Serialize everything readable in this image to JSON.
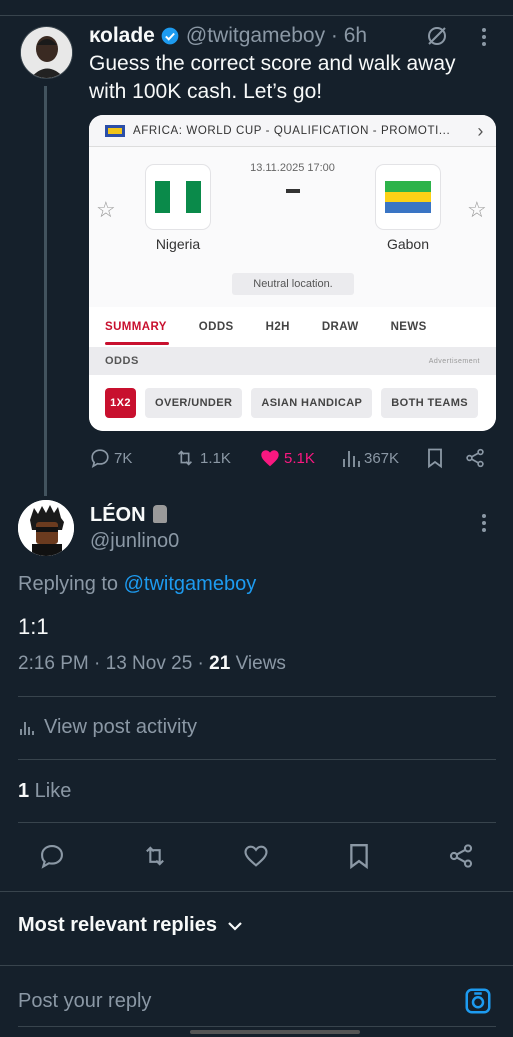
{
  "tweet": {
    "name": "κοlade",
    "handle": "@twitgameboy · 6h",
    "text": "Guess the correct score and walk away with 100K cash. Let’s go!",
    "card": {
      "competition": "AFRICA: WORLD CUP - QUALIFICATION - PROMOTI...",
      "datetime": "13.11.2025 17:00",
      "score": "-",
      "home_team": "Nigeria",
      "away_team": "Gabon",
      "venue_note": "Neutral location.",
      "tabs": [
        "SUMMARY",
        "ODDS",
        "H2H",
        "DRAW",
        "NEWS"
      ],
      "odds_label": "ODDS",
      "ad_label": "Advertisement",
      "pills": [
        "1X2",
        "OVER/UNDER",
        "ASIAN HANDICAP",
        "BOTH TEAMS"
      ]
    },
    "stats": {
      "replies": "7K",
      "reposts": "1.1K",
      "likes": "5.1K",
      "views": "367K"
    }
  },
  "reply": {
    "name": "LÉON",
    "handle": "@junlino0",
    "replying_prefix": "Replying to ",
    "replying_handle": "@twitgameboy",
    "text": "1:1",
    "time": "2:16 PM · 13 Nov 25 · ",
    "views_count": "21",
    "views_label": " Views",
    "activity_label": "View post activity",
    "like_count": "1",
    "like_label": " Like"
  },
  "sort_label": "Most relevant replies",
  "compose_placeholder": "Post your reply",
  "colors": {
    "background": "#15202b",
    "accent": "#1d9bf0",
    "like_pink": "#f91880",
    "muted": "#8b98a5"
  }
}
